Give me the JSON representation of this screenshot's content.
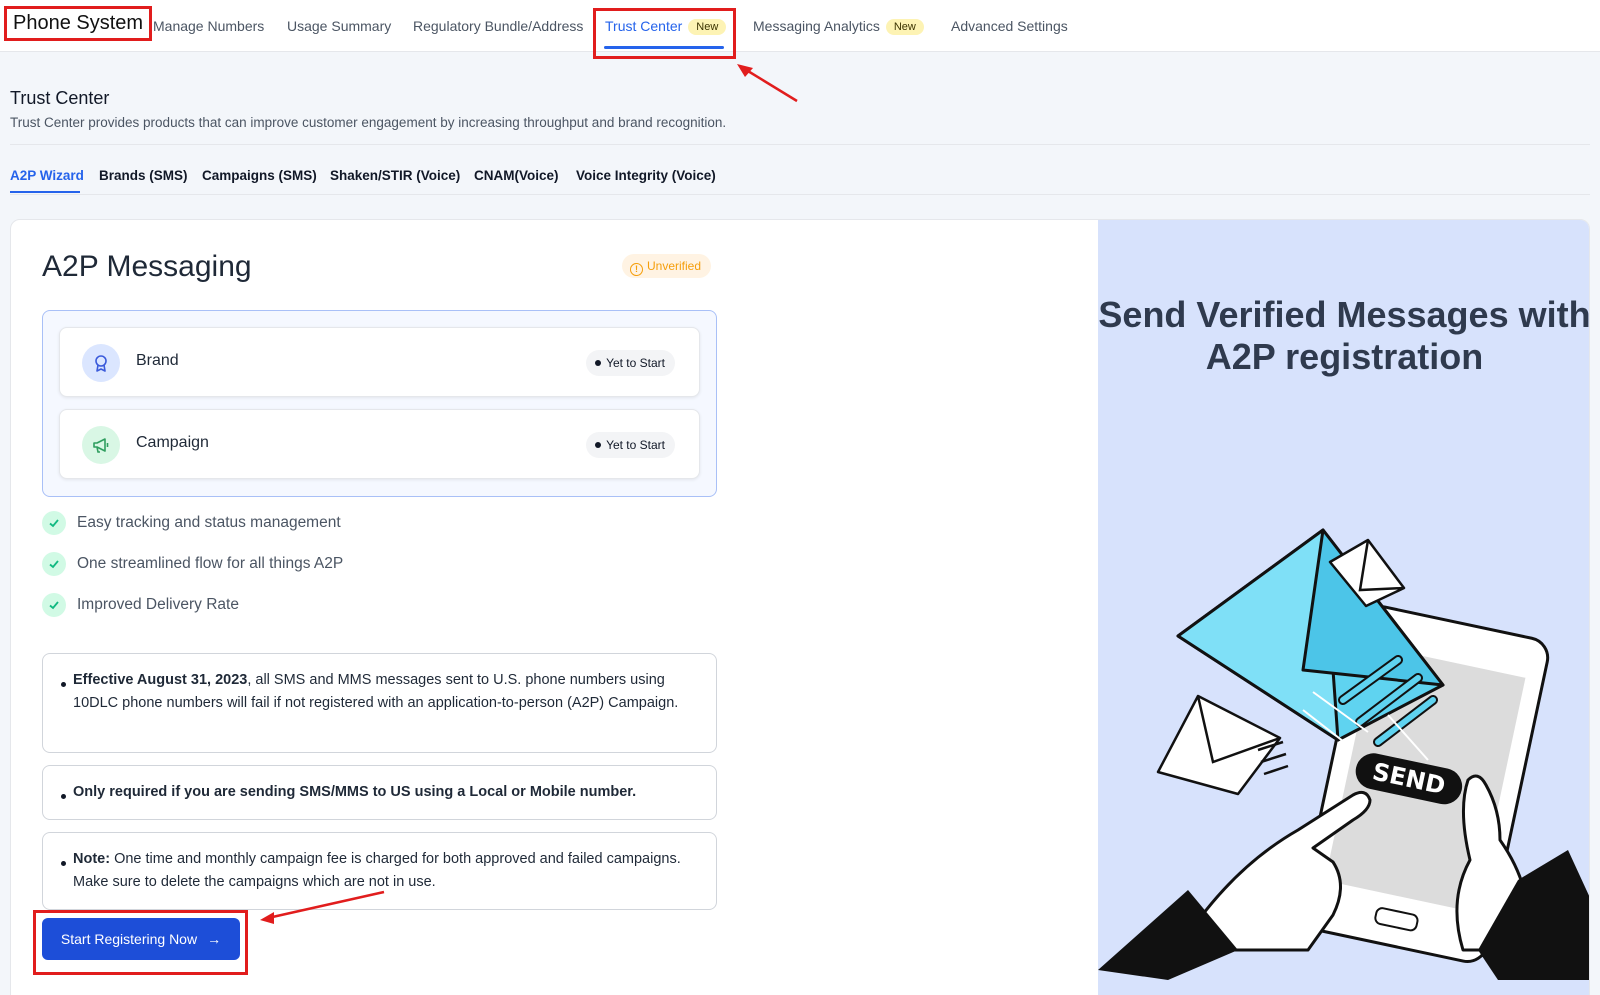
{
  "nav": {
    "app_title": "Phone System",
    "tabs": [
      {
        "label": "Manage Numbers"
      },
      {
        "label": "Usage Summary"
      },
      {
        "label": "Regulatory Bundle/Address"
      },
      {
        "label": "Trust Center",
        "badge": "New"
      },
      {
        "label": "Messaging Analytics",
        "badge": "New"
      },
      {
        "label": "Advanced Settings"
      }
    ]
  },
  "header": {
    "title": "Trust Center",
    "subtitle": "Trust Center provides products that can improve customer engagement by increasing throughput and brand recognition."
  },
  "subtabs": [
    "A2P Wizard",
    "Brands (SMS)",
    "Campaigns (SMS)",
    "Shaken/STIR (Voice)",
    "CNAM(Voice)",
    "Voice Integrity (Voice)"
  ],
  "card": {
    "title": "A2P Messaging",
    "status": "Unverified",
    "steps": [
      {
        "label": "Brand",
        "status": "Yet to Start"
      },
      {
        "label": "Campaign",
        "status": "Yet to Start"
      }
    ],
    "benefits": [
      "Easy tracking and status management",
      "One streamlined flow for all things A2P",
      "Improved Delivery Rate"
    ],
    "notes": {
      "n1_bold": "Effective August 31, 2023",
      "n1_rest": ", all SMS and MMS messages sent to U.S. phone numbers using 10DLC phone numbers will fail if not registered with an application-to-person (A2P) Campaign.",
      "n2_bold": "Only required if you are sending SMS/MMS to US using a Local or Mobile number.",
      "n3_bold": "Note:",
      "n3_rest": " One time and monthly campaign fee is charged for both approved and failed campaigns. Make sure to delete the campaigns which are not in use."
    },
    "cta": "Start Registering Now"
  },
  "promo": {
    "title": "Send Verified Messages with A2P registration",
    "send_label": "SEND"
  },
  "colors": {
    "accent": "#2563eb",
    "highlight": "#e11d1d",
    "promo_bg": "#d7e2fc",
    "success": "#10b981",
    "warning": "#f59e0b"
  }
}
